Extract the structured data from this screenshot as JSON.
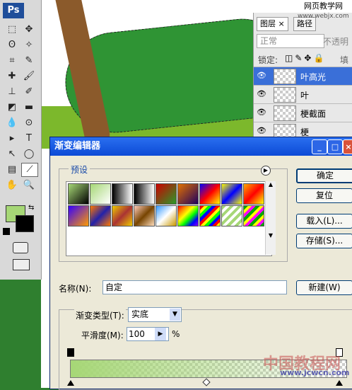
{
  "app": {
    "logo": "Ps"
  },
  "watermark": {
    "line1": "网页教学网",
    "line2": "www.webjx.com"
  },
  "tools": [
    {
      "name": "marquee-icon",
      "glyph": "⬚"
    },
    {
      "name": "move-icon",
      "glyph": "✥"
    },
    {
      "name": "lasso-icon",
      "glyph": "ʘ"
    },
    {
      "name": "magic-wand-icon",
      "glyph": "✧"
    },
    {
      "name": "crop-icon",
      "glyph": "⌗"
    },
    {
      "name": "slice-icon",
      "glyph": "✎"
    },
    {
      "name": "healing-brush-icon",
      "glyph": "✚"
    },
    {
      "name": "brush-icon",
      "glyph": "🖌"
    },
    {
      "name": "stamp-icon",
      "glyph": "⊥"
    },
    {
      "name": "history-brush-icon",
      "glyph": "✐"
    },
    {
      "name": "eraser-icon",
      "glyph": "◩"
    },
    {
      "name": "gradient-icon",
      "glyph": "▬"
    },
    {
      "name": "blur-icon",
      "glyph": "💧"
    },
    {
      "name": "dodge-icon",
      "glyph": "⊙"
    },
    {
      "name": "path-select-icon",
      "glyph": "▸"
    },
    {
      "name": "type-icon",
      "glyph": "T"
    },
    {
      "name": "pen-icon",
      "glyph": "↖"
    },
    {
      "name": "shape-icon",
      "glyph": "◯"
    },
    {
      "name": "notes-icon",
      "glyph": "▤"
    },
    {
      "name": "eyedropper-icon",
      "glyph": "⟋"
    },
    {
      "name": "hand-icon",
      "glyph": "✋"
    },
    {
      "name": "zoom-icon",
      "glyph": "🔍"
    }
  ],
  "layers_panel": {
    "tab_layers": "图层",
    "tab_paths": "路径",
    "blend_mode": "正常",
    "opacity_label": "不透明",
    "lock_label": "锁定:",
    "fill_label": "填",
    "layers": [
      {
        "name": "叶高光",
        "selected": true
      },
      {
        "name": "叶",
        "selected": false
      },
      {
        "name": "梗截面",
        "selected": false
      },
      {
        "name": "梗",
        "selected": false
      }
    ]
  },
  "dialog": {
    "title": "渐变编辑器",
    "presets_label": "预设",
    "buttons": {
      "ok": "确定",
      "reset": "复位",
      "load": "载入(L)...",
      "save": "存储(S)...",
      "new": "新建(W)"
    },
    "name_label": "名称(N):",
    "name_value": "自定",
    "gradient_type_label": "渐变类型(T):",
    "gradient_type_value": "实底",
    "smoothness_label": "平滑度(M):",
    "smoothness_value": "100",
    "percent": "%"
  },
  "swatches": [
    "linear-gradient(135deg,#a6d776,#000)",
    "linear-gradient(135deg,#a6d776,#fff)",
    "linear-gradient(90deg,#000,#fff)",
    "linear-gradient(90deg,#000,#fff0)",
    "linear-gradient(135deg,#c00,#2a9a2a)",
    "linear-gradient(135deg,#e07000,#200060)",
    "linear-gradient(135deg,#00f,#f00,#ff0)",
    "linear-gradient(135deg,#ff0,#00f,#ff0)",
    "linear-gradient(135deg,#fa0,#f00,#ff0)",
    "linear-gradient(135deg,#30f,#f90)",
    "linear-gradient(135deg,#f70,#22a,#f70)",
    "linear-gradient(135deg,#ec0,#a33,#ec0)",
    "linear-gradient(135deg,#fcb,#740,#fdb)",
    "linear-gradient(135deg,#39f,#fff,#c90)",
    "linear-gradient(135deg,#f00,#f80,#ff0,#0f0,#00f,#80f)",
    "repeating-linear-gradient(135deg,#f00 0 4px,#ff0 4px 8px,#0f0 8px 12px,#00f 12px 16px)",
    "repeating-linear-gradient(135deg,#a6d776 0 4px,#fff 4px 8px)",
    "repeating-linear-gradient(135deg,#0a0 0 4px,#ff0 4px 8px,#f0f 8px 12px)"
  ],
  "credit": {
    "line1": "中国教程网",
    "line2": "www.jcwcn.com"
  }
}
